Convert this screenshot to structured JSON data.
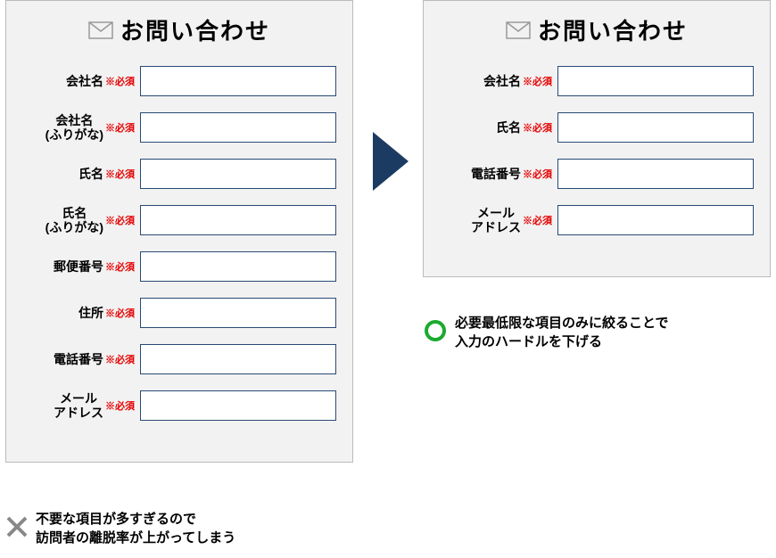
{
  "title": "お問い合わせ",
  "required_marker": "※必須",
  "formLeft": {
    "fields": [
      {
        "label": "会社名"
      },
      {
        "label": "会社名\n(ふりがな)"
      },
      {
        "label": "氏名"
      },
      {
        "label": "氏名\n(ふりがな)"
      },
      {
        "label": "郵便番号"
      },
      {
        "label": "住所"
      },
      {
        "label": "電話番号"
      },
      {
        "label": "メール\nアドレス"
      }
    ]
  },
  "formRight": {
    "fields": [
      {
        "label": "会社名"
      },
      {
        "label": "氏名"
      },
      {
        "label": "電話番号"
      },
      {
        "label": "メール\nアドレス"
      }
    ]
  },
  "captionBad": "不要な項目が多すぎるので\n訪問者の離脱率が上がってしまう",
  "captionGood": "必要最低限な項目のみに絞ることで\n入力のハードルを下げる"
}
